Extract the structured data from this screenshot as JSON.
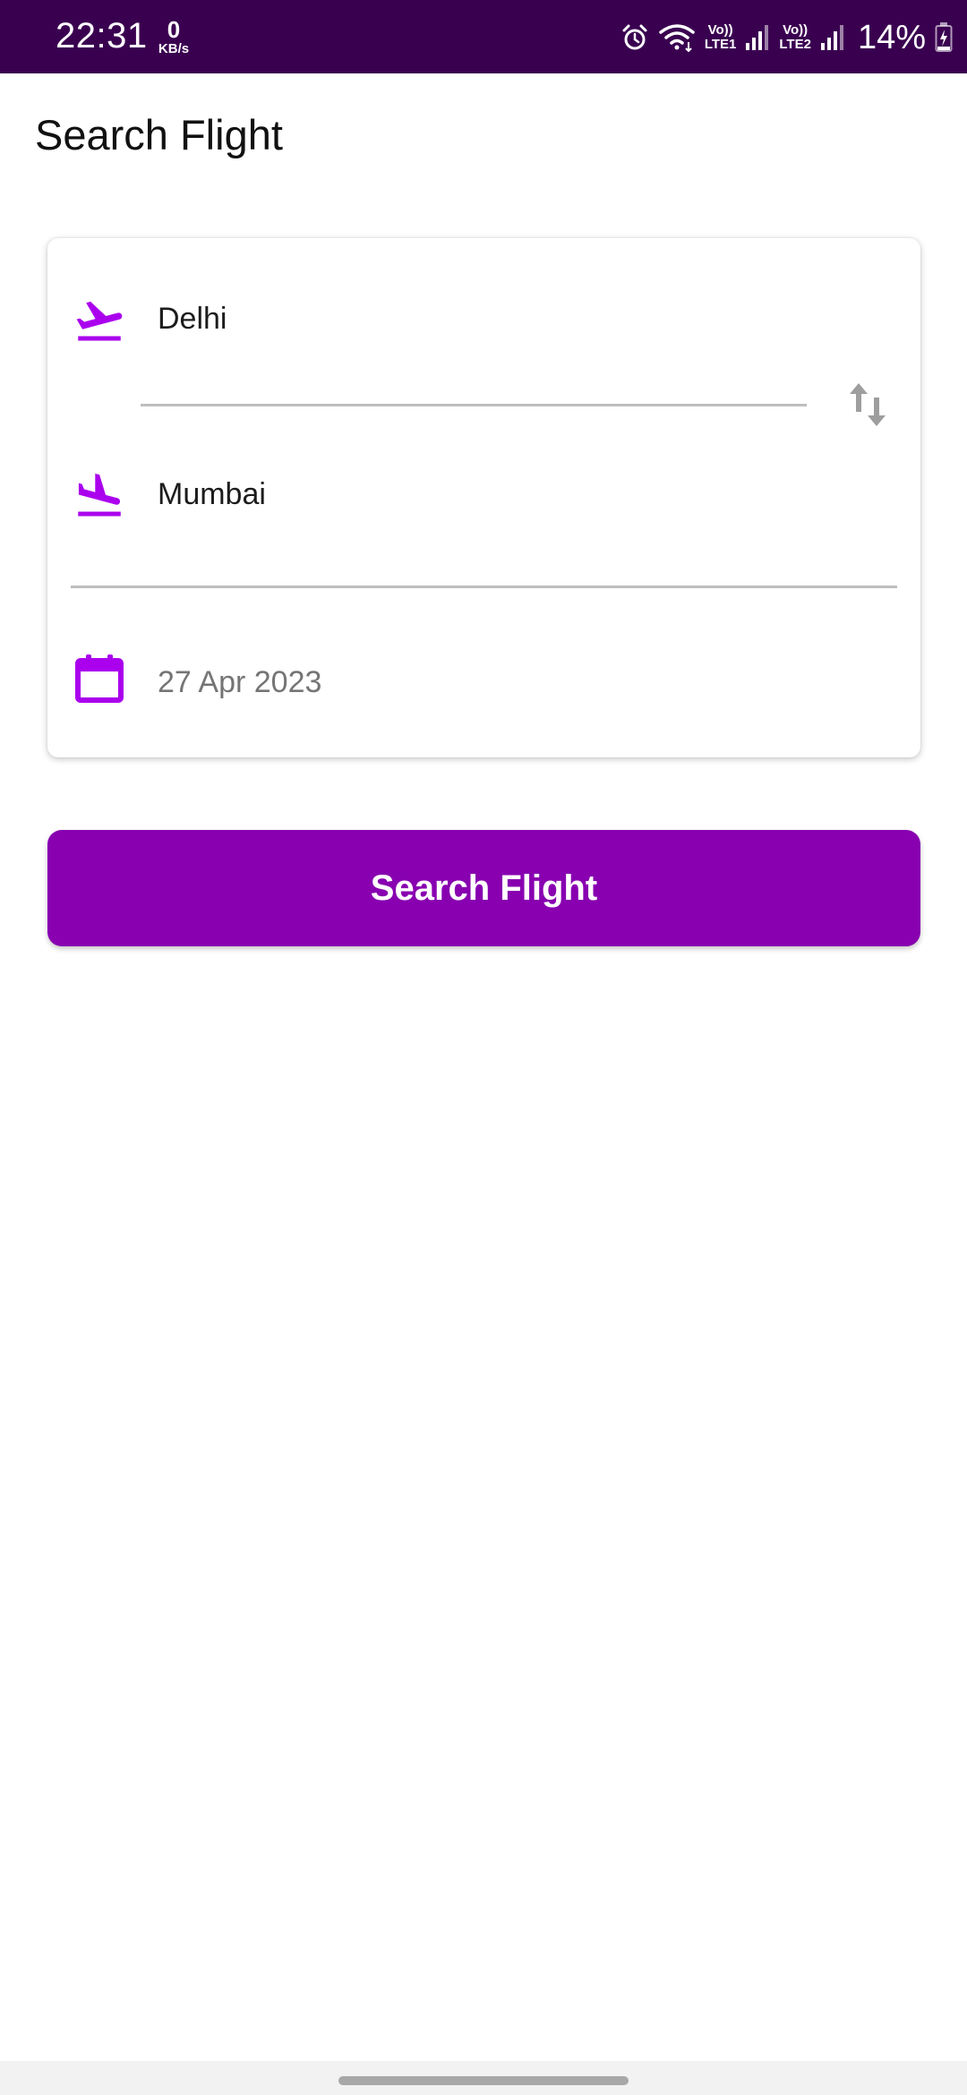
{
  "status_bar": {
    "time": "22:31",
    "net_speed_value": "0",
    "net_speed_unit": "KB/s",
    "sim1_volte": "Vo))",
    "sim1_label": "LTE1",
    "sim2_volte": "Vo))",
    "sim2_label": "LTE2",
    "battery_percent": "14%",
    "icons": [
      "alarm-icon",
      "wifi-icon",
      "signal-icon",
      "signal-icon",
      "battery-charging-icon"
    ]
  },
  "page": {
    "title": "Search Flight"
  },
  "form": {
    "from_city": "Delhi",
    "to_city": "Mumbai",
    "date": "27 Apr 2023",
    "from_icon": "flight-takeoff-icon",
    "to_icon": "flight-land-icon",
    "date_icon": "calendar-icon",
    "swap_icon": "swap-vertical-icon"
  },
  "actions": {
    "search_label": "Search Flight"
  },
  "colors": {
    "status_bar": "#3a0050",
    "accent": "#aa00ee",
    "button": "#8800b0",
    "divider": "#bdbdbd"
  }
}
